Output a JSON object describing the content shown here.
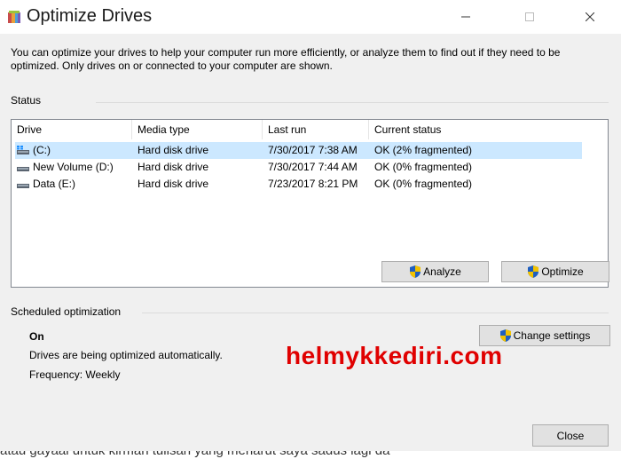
{
  "window": {
    "title": "Optimize Drives"
  },
  "description": "You can optimize your drives to help your computer run more efficiently, or analyze them to find out if they need to be optimized. Only drives on or connected to your computer are shown.",
  "status_label": "Status",
  "table": {
    "columns": [
      "Drive",
      "Media type",
      "Last run",
      "Current status"
    ],
    "rows": [
      {
        "drive": "(C:)",
        "media": "Hard disk drive",
        "last_run": "7/30/2017 7:38 AM",
        "status": "OK (2% fragmented)",
        "icon": "windows-drive-icon",
        "selected": true
      },
      {
        "drive": "New Volume (D:)",
        "media": "Hard disk drive",
        "last_run": "7/30/2017 7:44 AM",
        "status": "OK (0% fragmented)",
        "icon": "drive-icon",
        "selected": false
      },
      {
        "drive": "Data (E:)",
        "media": "Hard disk drive",
        "last_run": "7/23/2017 8:21 PM",
        "status": "OK (0% fragmented)",
        "icon": "drive-icon",
        "selected": false
      }
    ]
  },
  "buttons": {
    "analyze": "Analyze",
    "optimize": "Optimize",
    "change_settings": "Change settings",
    "close": "Close"
  },
  "scheduled": {
    "label": "Scheduled optimization",
    "state": "On",
    "info": "Drives are being optimized automatically.",
    "frequency": "Frequency: Weekly"
  },
  "watermark": "helmykkediri.com",
  "bottom_strip": "atau gayaal untuk kirman tulisan yang menarut saya sadus lagi da",
  "colors": {
    "selection": "#cce8ff",
    "watermark": "#e00000",
    "shield_blue": "#1f5fbf",
    "shield_yellow": "#f2c200"
  }
}
